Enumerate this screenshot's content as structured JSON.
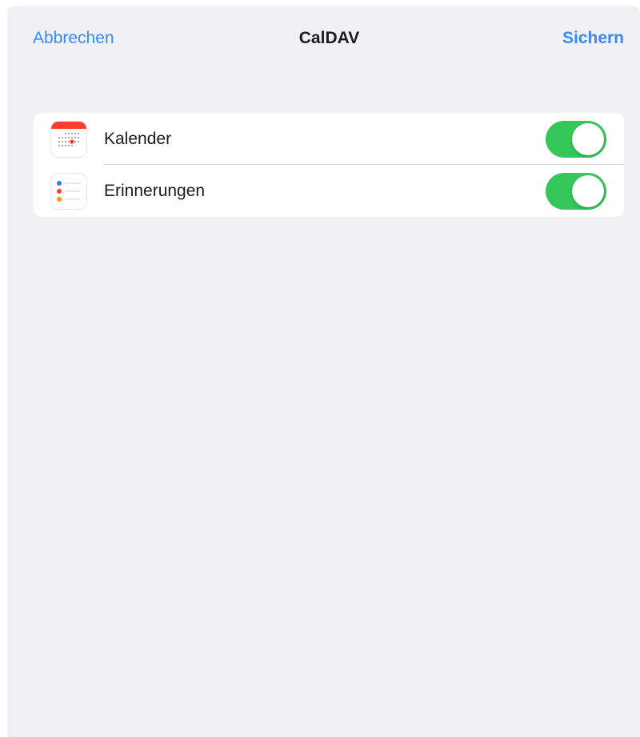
{
  "navbar": {
    "cancel_label": "Abbrechen",
    "title": "CalDAV",
    "save_label": "Sichern"
  },
  "rows": [
    {
      "label": "Kalender",
      "icon": "calendar-app-icon",
      "enabled": true
    },
    {
      "label": "Erinnerungen",
      "icon": "reminders-app-icon",
      "enabled": true
    }
  ],
  "colors": {
    "accent": "#3a8bf0",
    "toggle_on": "#34c759",
    "background": "#f0f0f5",
    "calendar_red": "#ff3b30"
  }
}
